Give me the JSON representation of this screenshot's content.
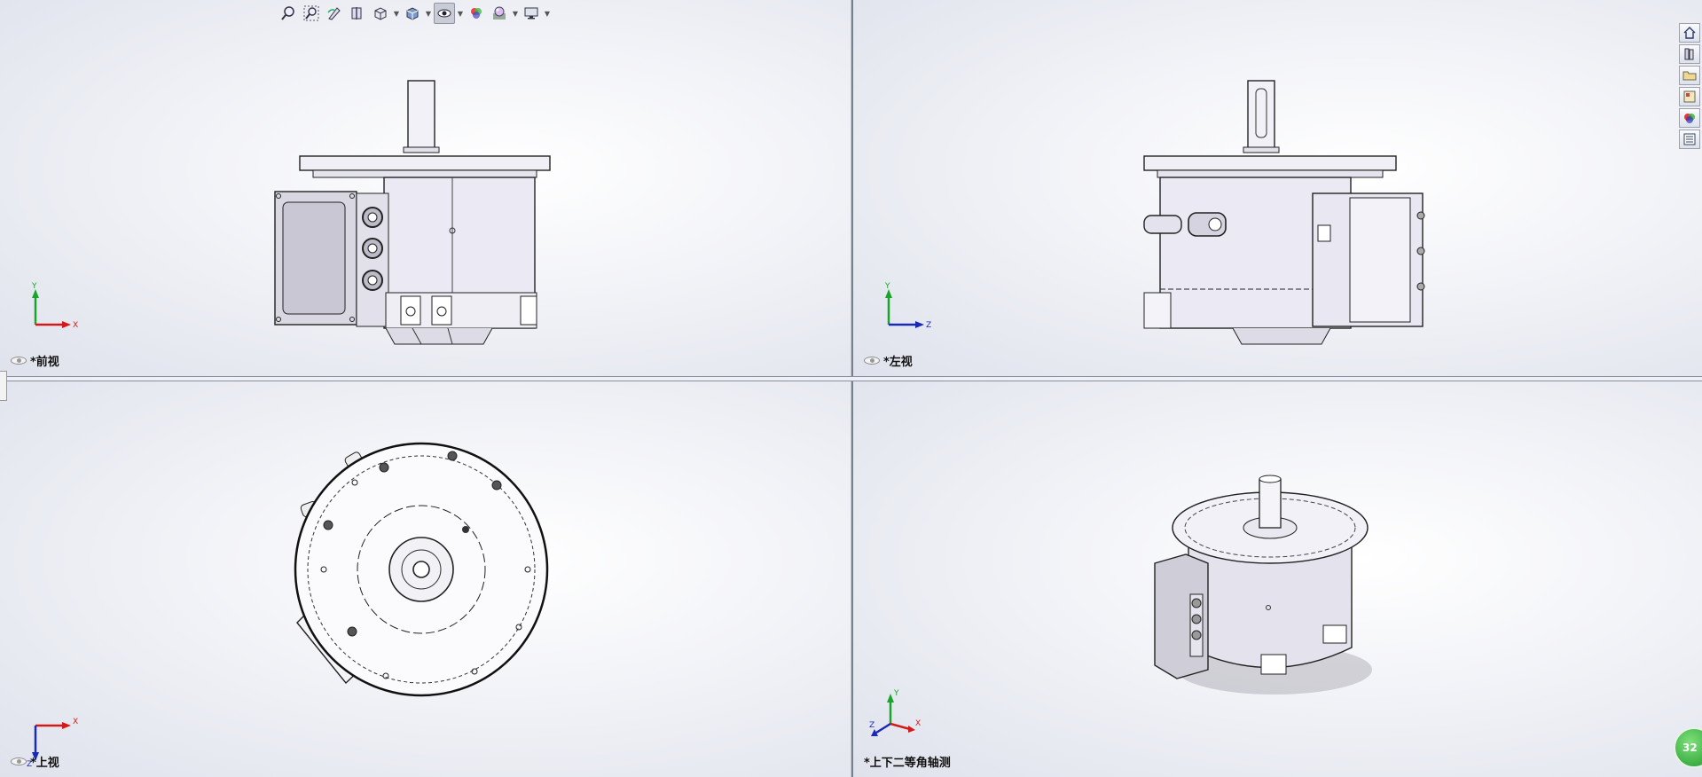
{
  "views": {
    "front": {
      "label": "*前视",
      "axes": [
        "Y",
        "X"
      ]
    },
    "left": {
      "label": "*左视",
      "axes": [
        "Y",
        "Z"
      ]
    },
    "top": {
      "label": "*上视",
      "axes": [
        "X",
        "Z"
      ]
    },
    "iso": {
      "label": "*上下二等角轴测",
      "axes": [
        "Y",
        "X",
        "Z"
      ]
    }
  },
  "toolbar": {
    "icons": [
      "zoom-to-fit-icon",
      "zoom-to-area-icon",
      "previous-view-icon",
      "section-view-icon",
      "view-orientation-icon",
      "display-style-icon",
      "hide-show-items-icon",
      "edit-appearance-icon",
      "apply-scene-icon",
      "view-settings-icon"
    ]
  },
  "task_pane": {
    "icons": [
      "home-icon",
      "design-library-icon",
      "file-explorer-icon",
      "view-palette-icon",
      "appearances-icon",
      "custom-properties-icon"
    ]
  },
  "notification": {
    "count": "32"
  },
  "colors": {
    "triad_x": "#d11a1a",
    "triad_y": "#1aa52a",
    "triad_z": "#1a2ab5",
    "model_fill": "#ebe9f3",
    "model_stroke": "#222222"
  }
}
